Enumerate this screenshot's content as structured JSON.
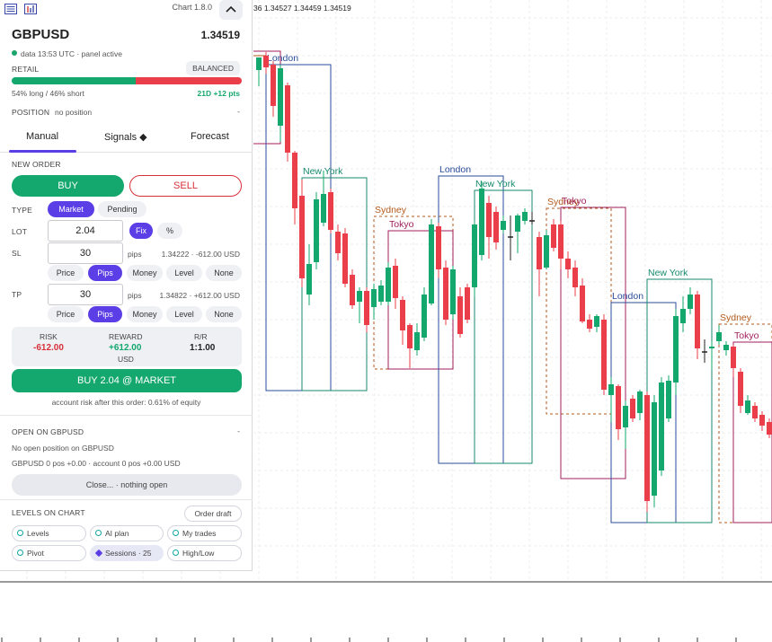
{
  "header": {
    "chart_version": "Chart 1.8.0",
    "ohlc_readout": "36 1.34527 1.34459 1.34519"
  },
  "instrument": {
    "symbol": "GBPUSD",
    "price": "1.34519",
    "data_status": "data 13:53 UTC · panel active"
  },
  "retail": {
    "label": "RETAIL",
    "badge": "BALANCED",
    "long_fraction": 0.54,
    "split_text": "54% long / 46% short",
    "change_text": "21D +12 pts"
  },
  "position": {
    "label": "POSITION",
    "value": "no position",
    "dash": "-"
  },
  "tabs": [
    {
      "label": "Manual",
      "active": true
    },
    {
      "label": "Signals ◆",
      "active": false
    },
    {
      "label": "Forecast",
      "active": false
    }
  ],
  "order": {
    "section_label": "NEW ORDER",
    "buy_label": "BUY",
    "sell_label": "SELL",
    "type_label": "TYPE",
    "type_options": [
      "Market",
      "Pending"
    ],
    "lot_label": "LOT",
    "lot_value": "2.04",
    "lot_modes": [
      "Fix",
      "%"
    ],
    "sl_label": "SL",
    "sl_value": "30",
    "sl_unit": "pips",
    "sl_info": "1.34222 · -612.00 USD",
    "tp_label": "TP",
    "tp_value": "30",
    "tp_unit": "pips",
    "tp_info": "1.34822 · +612.00 USD",
    "unit_options": [
      "Price",
      "Pips",
      "Money",
      "Level",
      "None"
    ],
    "risk_label": "RISK",
    "risk_value": "-612.00",
    "reward_label": "REWARD",
    "reward_value": "+612.00",
    "reward_currency": "USD",
    "rr_label": "R/R",
    "rr_value": "1:1.00",
    "submit_label": "BUY 2.04 @ MARKET",
    "risk_note": "account risk after this order: 0.61% of equity"
  },
  "open_positions": {
    "title": "OPEN ON GBPUSD",
    "dash": "-",
    "line1": "No open position on GBPUSD",
    "line2": "GBPUSD 0 pos +0.00 · account 0 pos +0.00 USD",
    "close_label": "Close... · nothing open"
  },
  "levels": {
    "title": "LEVELS ON CHART",
    "order_draft": "Order draft",
    "chips": [
      {
        "label": "Levels",
        "active": false
      },
      {
        "label": "AI plan",
        "active": false
      },
      {
        "label": "My trades",
        "active": false
      },
      {
        "label": "Pivot",
        "active": false
      },
      {
        "label": "Sessions · 25",
        "active": true
      },
      {
        "label": "High/Low",
        "active": false
      }
    ]
  },
  "colors": {
    "bull": "#14a86e",
    "bear": "#ea3f4a",
    "accent": "#5b3ee6",
    "london": "#2a4d9a",
    "new_york": "#178a6c",
    "sydney": "#b35a1a",
    "tokyo": "#a01f5b"
  },
  "chart_sessions": [
    {
      "name": "London",
      "color": "london"
    },
    {
      "name": "New York",
      "color": "new_york"
    },
    {
      "name": "Sydney",
      "color": "sydney"
    },
    {
      "name": "Tokyo",
      "color": "tokyo"
    },
    {
      "name": "London",
      "color": "london"
    },
    {
      "name": "New York",
      "color": "new_york"
    },
    {
      "name": "Sydney",
      "color": "sydney"
    },
    {
      "name": "Tokyo",
      "color": "tokyo"
    },
    {
      "name": "London",
      "color": "london"
    },
    {
      "name": "New York",
      "color": "new_york"
    },
    {
      "name": "Sydney",
      "color": "sydney"
    },
    {
      "name": "Tokyo",
      "color": "tokyo"
    }
  ]
}
